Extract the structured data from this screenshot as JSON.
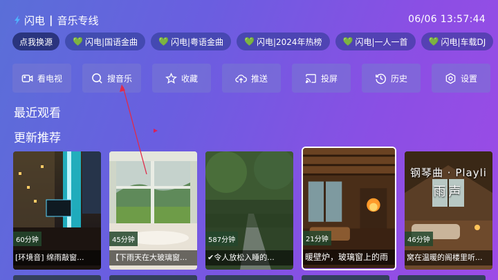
{
  "header": {
    "app_name": "闪电",
    "section": "音乐专线",
    "clock": "06/06 13:57:44"
  },
  "chips": [
    {
      "label": "点我换源",
      "heart": false
    },
    {
      "label": "闪电|国语金曲",
      "heart": true
    },
    {
      "label": "闪电|粤语金曲",
      "heart": true
    },
    {
      "label": "闪电|2024年热榜",
      "heart": true
    },
    {
      "label": "闪电|一人一首",
      "heart": true
    },
    {
      "label": "闪电|车载DJ",
      "heart": true
    }
  ],
  "actions": [
    {
      "label": "看电视",
      "icon": "tv-camera-icon"
    },
    {
      "label": "搜音乐",
      "icon": "search-icon"
    },
    {
      "label": "收藏",
      "icon": "star-icon"
    },
    {
      "label": "推送",
      "icon": "cloud-upload-icon"
    },
    {
      "label": "投屏",
      "icon": "cast-icon"
    },
    {
      "label": "历史",
      "icon": "history-icon"
    },
    {
      "label": "设置",
      "icon": "settings-icon"
    }
  ],
  "sections": {
    "recent": "最近观看",
    "recommended": "更新推荐"
  },
  "cards": [
    {
      "duration": "60分钟",
      "title": "[环境音] 绵雨敲窗..."
    },
    {
      "duration": "45分钟",
      "title": "【下雨天在大玻璃窗..."
    },
    {
      "duration": "587分钟",
      "title": "✔令人放松入睡的..."
    },
    {
      "duration": "21分钟",
      "title": "暖壁炉，玻璃窗上的雨"
    },
    {
      "duration": "46分钟",
      "title": "窝在温暖的阁楼里听...",
      "banner": "钢琴曲 · Playli",
      "banner2": "雨声"
    }
  ],
  "colors": {
    "accent_heart": "#7bd34b",
    "pointer": "#d8205a",
    "selected_border": "#ffffff"
  }
}
